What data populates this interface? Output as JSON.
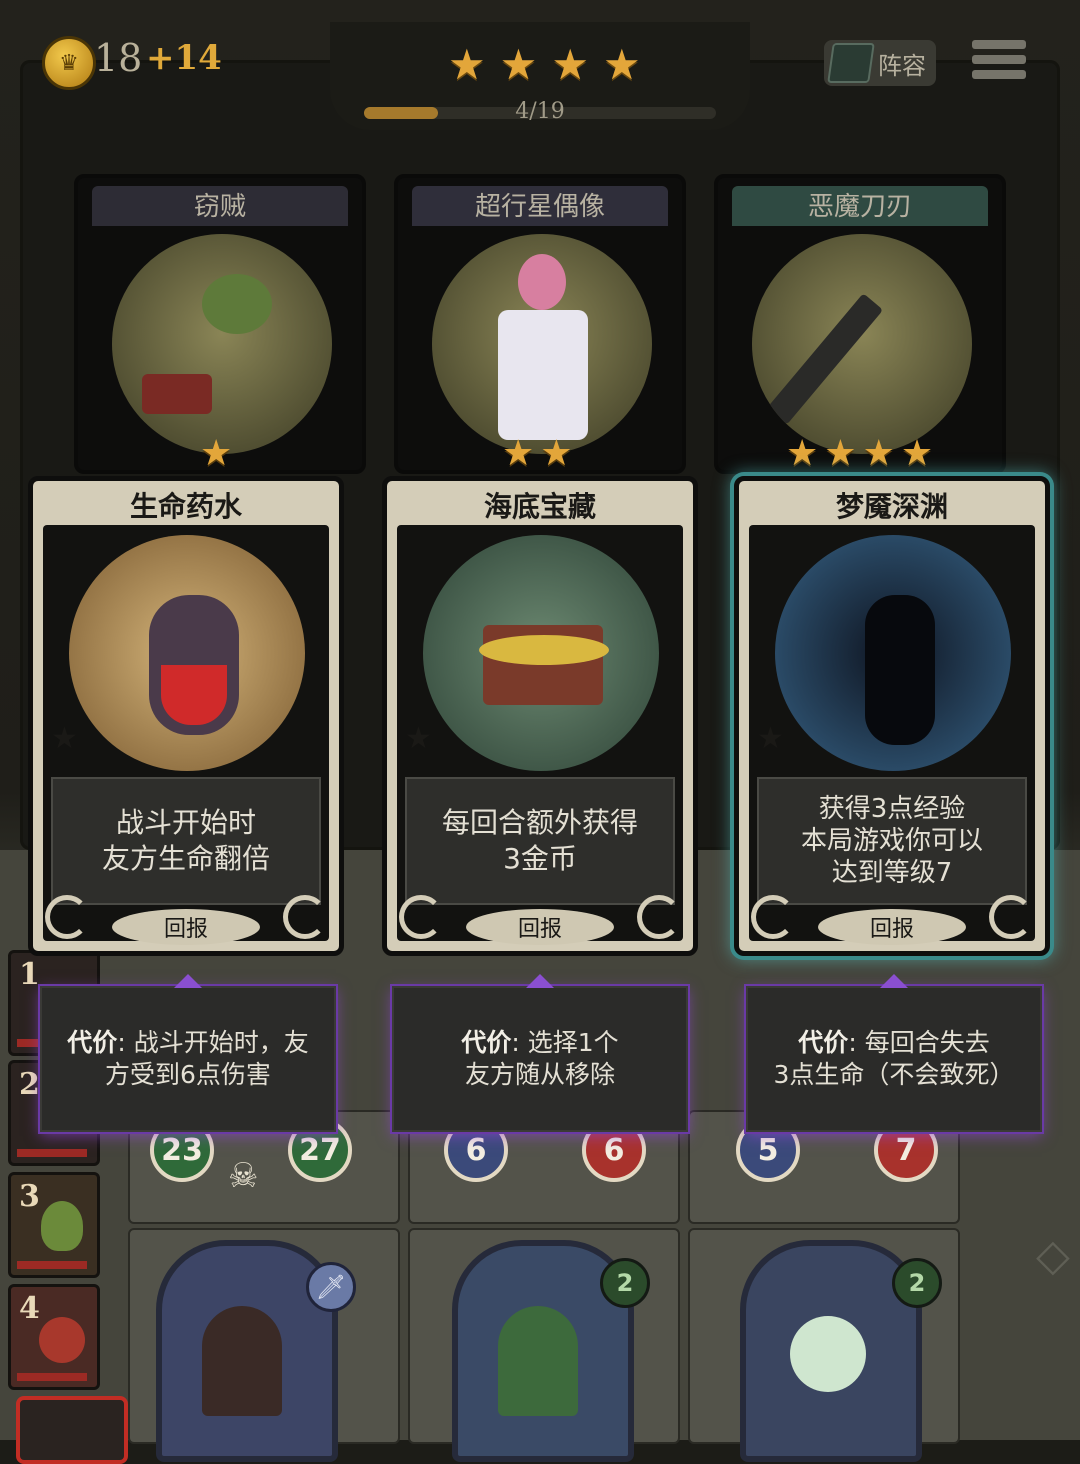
{
  "resources": {
    "gold": "18",
    "income": "+14"
  },
  "tier": {
    "stars": 4,
    "progress_label": "4/19",
    "progress_fraction": 0.21
  },
  "header": {
    "team_button": "阵容"
  },
  "top_cards": [
    {
      "name": "窃贼",
      "stars": 1,
      "accent": "#2d2c35"
    },
    {
      "name": "超行星偶像",
      "stars": 2,
      "accent": "#2f2e3a"
    },
    {
      "name": "恶魔刀刃",
      "stars": 4,
      "accent": "#2f4a42"
    }
  ],
  "offers": [
    {
      "title": "生命药水",
      "desc": [
        "战斗开始时",
        "友方生命翻倍"
      ],
      "reward": "回报",
      "cost_label": "代价",
      "cost": [
        "战斗开始时，友",
        "方受到6点伤害"
      ]
    },
    {
      "title": "海底宝藏",
      "desc": [
        "每回合额外获得",
        "3金币"
      ],
      "reward": "回报",
      "cost_label": "代价",
      "cost": [
        "选择1个",
        "友方随从移除"
      ]
    },
    {
      "title": "梦魇深渊",
      "desc": [
        "获得3点经验",
        "本局游戏你可以",
        "达到等级7"
      ],
      "reward": "回报",
      "cost_label": "代价",
      "cost": [
        "每回合失去",
        "3点生命（不会致死）"
      ],
      "selected": true
    }
  ],
  "side_units": [
    "1",
    "2",
    "3",
    "4"
  ],
  "board_stats": [
    {
      "attack": "23",
      "health": "27"
    },
    {
      "attack": "6",
      "health": "6"
    },
    {
      "attack": "5",
      "health": "7"
    }
  ],
  "minion_levels": [
    "2",
    "2"
  ]
}
